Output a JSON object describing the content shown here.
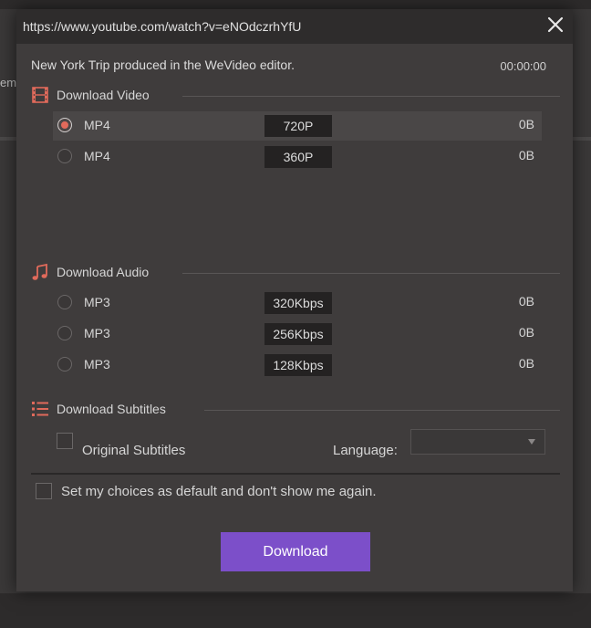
{
  "background": {
    "partial_text": "em"
  },
  "dialog": {
    "url": "https://www.youtube.com/watch?v=eNOdczrhYfU",
    "video_title": "New York Trip produced in the WeVideo editor.",
    "duration": "00:00:00"
  },
  "video_section": {
    "label": "Download Video",
    "options": [
      {
        "format": "MP4",
        "quality": "720P",
        "size": "0B",
        "selected": true
      },
      {
        "format": "MP4",
        "quality": "360P",
        "size": "0B",
        "selected": false
      }
    ]
  },
  "audio_section": {
    "label": "Download Audio",
    "options": [
      {
        "format": "MP3",
        "quality": "320Kbps",
        "size": "0B",
        "selected": false
      },
      {
        "format": "MP3",
        "quality": "256Kbps",
        "size": "0B",
        "selected": false
      },
      {
        "format": "MP3",
        "quality": "128Kbps",
        "size": "0B",
        "selected": false
      }
    ]
  },
  "subtitles_section": {
    "label": "Download Subtitles",
    "original_label": "Original Subtitles",
    "language_label": "Language:",
    "language_value": ""
  },
  "default_label": "Set my choices as default and don't show me again.",
  "download_button": "Download",
  "colors": {
    "accent": "#e06a5b",
    "button": "#7c4fc9"
  }
}
